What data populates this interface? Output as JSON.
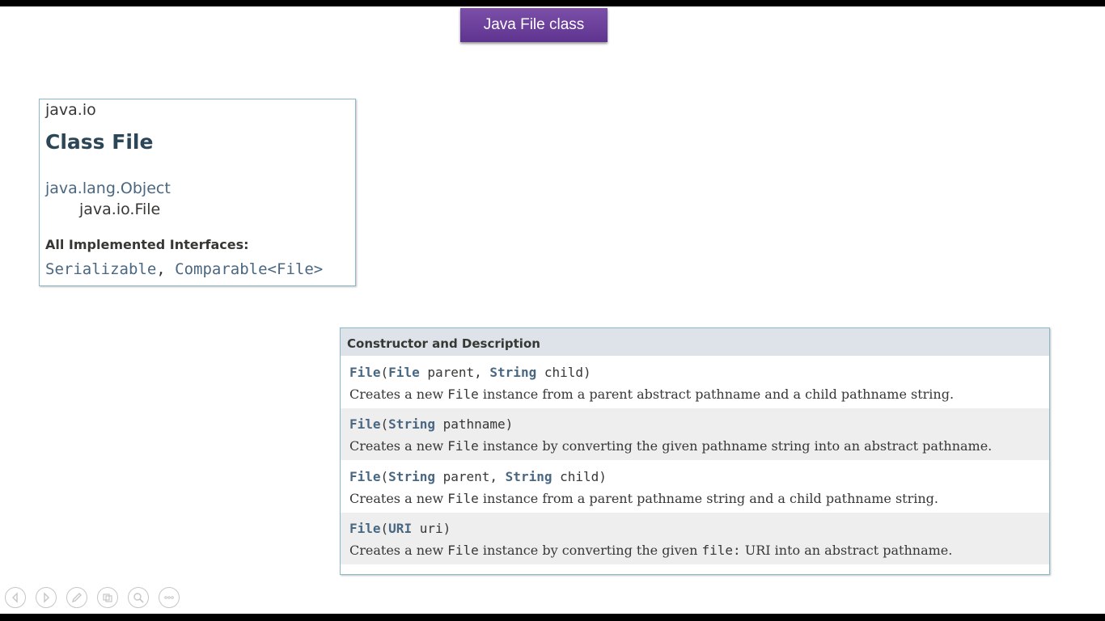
{
  "slide": {
    "title": "Java File class"
  },
  "class_box": {
    "package": "java.io",
    "class_title": "Class File",
    "inheritance": [
      "java.lang.Object",
      "java.io.File"
    ],
    "interfaces_heading": "All Implemented Interfaces:",
    "interfaces": [
      "Serializable",
      ", ",
      "Comparable<File>"
    ]
  },
  "constructors": {
    "header": "Constructor and Description",
    "rows": [
      {
        "sig": [
          {
            "t": "File",
            "b": true
          },
          {
            "t": "(",
            "b": false
          },
          {
            "t": "File",
            "b": true
          },
          {
            "t": " parent, ",
            "b": false
          },
          {
            "t": "String",
            "b": true
          },
          {
            "t": " child)",
            "b": false
          }
        ],
        "desc": [
          {
            "t": "Creates a new ",
            "c": false
          },
          {
            "t": "File",
            "c": true
          },
          {
            "t": " instance from a parent abstract pathname and a child pathname string.",
            "c": false
          }
        ]
      },
      {
        "sig": [
          {
            "t": "File",
            "b": true
          },
          {
            "t": "(",
            "b": false
          },
          {
            "t": "String",
            "b": true
          },
          {
            "t": " pathname)",
            "b": false
          }
        ],
        "desc": [
          {
            "t": "Creates a new ",
            "c": false
          },
          {
            "t": "File",
            "c": true
          },
          {
            "t": " instance by converting the given pathname string into an abstract pathname.",
            "c": false
          }
        ]
      },
      {
        "sig": [
          {
            "t": "File",
            "b": true
          },
          {
            "t": "(",
            "b": false
          },
          {
            "t": "String",
            "b": true
          },
          {
            "t": " parent, ",
            "b": false
          },
          {
            "t": "String",
            "b": true
          },
          {
            "t": " child)",
            "b": false
          }
        ],
        "desc": [
          {
            "t": "Creates a new ",
            "c": false
          },
          {
            "t": "File",
            "c": true
          },
          {
            "t": " instance from a parent pathname string and a child pathname string.",
            "c": false
          }
        ]
      },
      {
        "sig": [
          {
            "t": "File",
            "b": true
          },
          {
            "t": "(",
            "b": false
          },
          {
            "t": "URI",
            "b": true
          },
          {
            "t": " uri)",
            "b": false
          }
        ],
        "desc": [
          {
            "t": "Creates a new ",
            "c": false
          },
          {
            "t": "File",
            "c": true
          },
          {
            "t": " instance by converting the given ",
            "c": false
          },
          {
            "t": "file:",
            "c": true
          },
          {
            "t": " URI into an abstract pathname.",
            "c": false
          }
        ]
      }
    ]
  },
  "controls": [
    {
      "icon": "previous-slide-icon"
    },
    {
      "icon": "next-slide-icon"
    },
    {
      "icon": "pen-icon"
    },
    {
      "icon": "slides-grid-icon"
    },
    {
      "icon": "zoom-icon"
    },
    {
      "icon": "more-options-icon"
    }
  ],
  "colors": {
    "title_bg": "#6a3f99",
    "border": "#8cb8c8",
    "header_bg": "#dee3e9",
    "row_alt": "#eeeeef",
    "link": "#4a6782",
    "text": "#353833"
  }
}
